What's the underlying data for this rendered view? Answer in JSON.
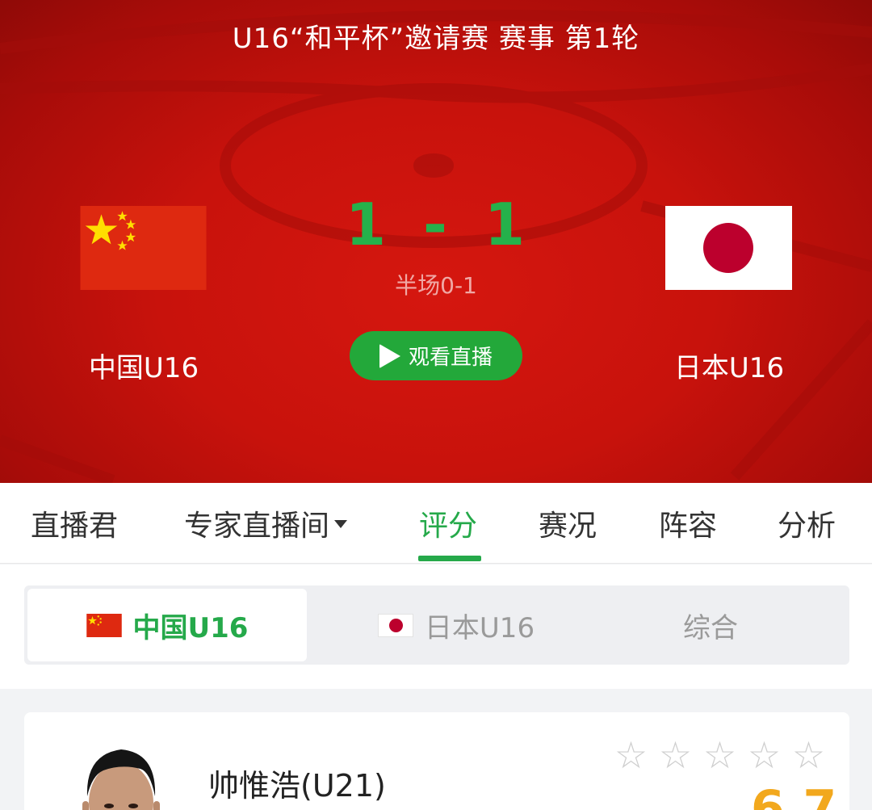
{
  "header": {
    "match_title": "U16“和平杯”邀请赛 赛事 第1轮",
    "home_team": "中国U16",
    "away_team": "日本U16",
    "home_score": "1",
    "score_separator": "-",
    "away_score": "1",
    "halftime": "半场0-1",
    "live_button": "观看直播"
  },
  "tabs": [
    {
      "label": "直播君"
    },
    {
      "label": "专家直播间"
    },
    {
      "label": "评分",
      "active": true
    },
    {
      "label": "赛况"
    },
    {
      "label": "阵容"
    },
    {
      "label": "分析"
    }
  ],
  "team_switch": {
    "home": "中国U16",
    "away": "日本U16",
    "all": "综合",
    "selected": "home"
  },
  "player": {
    "name": "帅惟浩(U21)",
    "stars_filled": 0,
    "stars_total": 5,
    "rating": "6.7"
  },
  "colors": {
    "header_red": "#c8120c",
    "accent_green": "#25a94a",
    "rating_orange": "#f2a81d"
  }
}
